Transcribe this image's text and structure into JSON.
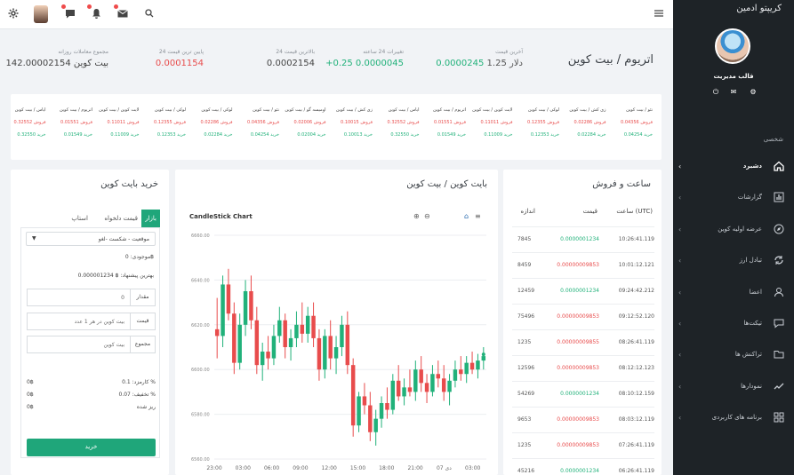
{
  "sidebar": {
    "brand": "کریپتو ادمین",
    "profile_name": "قالب مدیریت",
    "section_label": "شخصی",
    "items": [
      {
        "label": "دشبرد",
        "icon": "home-icon"
      },
      {
        "label": "گزارشات",
        "icon": "bar-chart-icon"
      },
      {
        "label": "عرضه اولیه کوین",
        "icon": "compass-icon"
      },
      {
        "label": "تبادل ارز",
        "icon": "exchange-icon"
      },
      {
        "label": "اعضا",
        "icon": "users-icon"
      },
      {
        "label": "تیکت‌ها",
        "icon": "chat-icon"
      },
      {
        "label": "تراکنش ها",
        "icon": "folder-icon"
      },
      {
        "label": "نمودارها",
        "icon": "trend-icon"
      },
      {
        "label": "برنامه های کاربردی",
        "icon": "apps-icon"
      }
    ]
  },
  "header": {
    "pair_title": "اتریوم / بیت کوین",
    "stats": [
      {
        "label": "آخرین قیمت",
        "value": "0.0000245",
        "extra": "1.25 دلار"
      },
      {
        "label": "تغییرات 24 ساعته",
        "value": "+0.25 0.0000045"
      },
      {
        "label": "بالاترین قیمت 24",
        "value": "0.0002154"
      },
      {
        "label": "پایین ترین قیمت 24",
        "value": "0.0001154"
      },
      {
        "label": "مجموع معاملات روزانه",
        "value": "142.00002154 بیت کوین"
      }
    ]
  },
  "ticker": [
    {
      "pair": "نئو / بیت کوین",
      "sell": "فروش 0.04356",
      "buy": "خرید 0.04254"
    },
    {
      "pair": "زی کش / بیت کوین",
      "sell": "فروش 0.02286",
      "buy": "خرید 0.02284"
    },
    {
      "pair": "لوکی / بیت کوین",
      "sell": "فروش 0.12355",
      "buy": "خرید 0.12353"
    },
    {
      "pair": "لایت کوین / بیت کوین",
      "sell": "فروش 0.11011",
      "buy": "خرید 0.11009"
    },
    {
      "pair": "اتریوم / بیت کوین",
      "sell": "فروش 0.01551",
      "buy": "خرید 0.01549"
    },
    {
      "pair": "ایاس / بیت کوین",
      "sell": "فروش 0.32552",
      "buy": "خرید 0.32550"
    },
    {
      "pair": "زی کش / بیت کوین",
      "sell": "فروش 0.10015",
      "buy": "خرید 0.10013"
    },
    {
      "pair": "اومیسه گو / بیت کوین",
      "sell": "فروش 0.02006",
      "buy": "خرید 0.02004"
    },
    {
      "pair": "نئو / بیت کوین",
      "sell": "فروش 0.04356",
      "buy": "خرید 0.04254"
    },
    {
      "pair": "لوکی / بیت کوین",
      "sell": "فروش 0.02286",
      "buy": "خرید 0.02284"
    },
    {
      "pair": "لوکی / بیت کوین",
      "sell": "فروش 0.12355",
      "buy": "خرید 0.12353"
    },
    {
      "pair": "لایت کوین / بیت کوین",
      "sell": "فروش 0.11011",
      "buy": "خرید 0.11009"
    },
    {
      "pair": "اتریوم / بیت کوین",
      "sell": "فروش 0.01551",
      "buy": "خرید 0.01549"
    },
    {
      "pair": "ایاس / بیت کوین",
      "sell": "فروش 0.32552",
      "buy": "خرید 0.32550"
    }
  ],
  "trades": {
    "title": "ساعت و فروش",
    "headers": [
      "ساعت (UTC)",
      "قیمت",
      "اندازه"
    ],
    "rows": [
      {
        "time": "10:26:41.119",
        "price": "0.0000001234",
        "size": "7845",
        "side": "buy"
      },
      {
        "time": "10:01:12.121",
        "price": "0.00000009853",
        "size": "8459",
        "side": "sell"
      },
      {
        "time": "09:24:42.212",
        "price": "0.0000001234",
        "size": "12459",
        "side": "buy"
      },
      {
        "time": "09:12:52.120",
        "price": "0.00000009853",
        "size": "75496",
        "side": "sell"
      },
      {
        "time": "08:26:41.119",
        "price": "0.00000009855",
        "size": "1235",
        "side": "sell"
      },
      {
        "time": "08:12:12.123",
        "price": "0.00000009853",
        "size": "12596",
        "side": "sell"
      },
      {
        "time": "08:10:12.159",
        "price": "0.0000001234",
        "size": "54269",
        "side": "buy"
      },
      {
        "time": "08:03:12.119",
        "price": "0.00000009853",
        "size": "9653",
        "side": "sell"
      },
      {
        "time": "07:26:41.119",
        "price": "0.00000009853",
        "size": "1235",
        "side": "sell"
      },
      {
        "time": "06:26:41.119",
        "price": "0.0000001234",
        "size": "45216",
        "side": "buy"
      }
    ]
  },
  "chart_card": {
    "title": "بایت کوین / بیت کوین"
  },
  "chart_data": {
    "type": "candlestick",
    "title": "CandleStick Chart",
    "ylim": [
      6560,
      6660
    ],
    "y_ticks": [
      "6660.00",
      "6640.00",
      "6620.00",
      "6600.00",
      "6580.00",
      "6560.00"
    ],
    "x_ticks": [
      "23:00",
      "03:00",
      "06:00",
      "09:00",
      "12:00",
      "15:00",
      "18:00",
      "21:00",
      "07 دی",
      "03:00"
    ],
    "candles": [
      [
        6618,
        6632,
        6605,
        6615
      ],
      [
        6615,
        6642,
        6610,
        6638
      ],
      [
        6638,
        6645,
        6622,
        6625
      ],
      [
        6625,
        6630,
        6598,
        6603
      ],
      [
        6603,
        6625,
        6600,
        6620
      ],
      [
        6620,
        6640,
        6615,
        6635
      ],
      [
        6635,
        6642,
        6618,
        6622
      ],
      [
        6622,
        6628,
        6598,
        6602
      ],
      [
        6602,
        6612,
        6595,
        6608
      ],
      [
        6608,
        6615,
        6600,
        6605
      ],
      [
        6605,
        6620,
        6602,
        6615
      ],
      [
        6615,
        6628,
        6612,
        6622
      ],
      [
        6622,
        6625,
        6605,
        6610
      ],
      [
        6610,
        6618,
        6604,
        6614
      ],
      [
        6614,
        6626,
        6610,
        6620
      ],
      [
        6620,
        6630,
        6612,
        6616
      ],
      [
        6616,
        6628,
        6612,
        6624
      ],
      [
        6624,
        6630,
        6610,
        6614
      ],
      [
        6614,
        6618,
        6595,
        6600
      ],
      [
        6600,
        6618,
        6596,
        6615
      ],
      [
        6615,
        6622,
        6600,
        6605
      ],
      [
        6605,
        6615,
        6598,
        6610
      ],
      [
        6610,
        6624,
        6606,
        6620
      ],
      [
        6620,
        6626,
        6598,
        6602
      ],
      [
        6602,
        6605,
        6570,
        6575
      ],
      [
        6575,
        6590,
        6572,
        6588
      ],
      [
        6588,
        6594,
        6580,
        6584
      ],
      [
        6584,
        6590,
        6568,
        6572
      ],
      [
        6572,
        6582,
        6566,
        6578
      ],
      [
        6578,
        6588,
        6574,
        6585
      ],
      [
        6585,
        6592,
        6578,
        6582
      ],
      [
        6582,
        6598,
        6580,
        6595
      ],
      [
        6595,
        6602,
        6586,
        6588
      ],
      [
        6588,
        6596,
        6584,
        6592
      ],
      [
        6592,
        6600,
        6588,
        6590
      ],
      [
        6590,
        6604,
        6586,
        6600
      ],
      [
        6600,
        6606,
        6590,
        6594
      ],
      [
        6594,
        6598,
        6585,
        6590
      ],
      [
        6590,
        6602,
        6588,
        6598
      ],
      [
        6598,
        6604,
        6592,
        6596
      ],
      [
        6596,
        6602,
        6586,
        6590
      ],
      [
        6590,
        6598,
        6584,
        6595
      ],
      [
        6595,
        6604,
        6592,
        6600
      ],
      [
        6600,
        6606,
        6595,
        6598
      ],
      [
        6598,
        6606,
        6594,
        6603
      ],
      [
        6603,
        6608,
        6598,
        6600
      ],
      [
        6600,
        6607,
        6596,
        6604
      ],
      [
        6604,
        6610,
        6600,
        6606
      ]
    ]
  },
  "buy_card": {
    "title": "خرید بایت کوین",
    "tabs": [
      "بازار",
      "قیمت دلخواه",
      "استاپ"
    ],
    "status_value": "موقعیت - شکست -لغو",
    "available": "موجودی: 0฿",
    "best_offer": "بهترین پیشنهاد: ฿ 0.000001234",
    "fields": [
      {
        "label": "مقدار",
        "value": "0"
      },
      {
        "label": "قیمت",
        "value": "بیت کوین در هر 1 عدد"
      },
      {
        "label": "مجموع",
        "value": "بیت کوین"
      }
    ],
    "fees": [
      {
        "label": "کارمزد: 0.1 %",
        "value": "0฿"
      },
      {
        "label": "تخفیف: 0.07 %",
        "value": "0฿"
      },
      {
        "label": "ریز شده",
        "value": "0฿"
      }
    ],
    "buy_label": "خرید"
  },
  "colors": {
    "green": "#21b17a",
    "red": "#e84c4c",
    "sidebar": "#1e2327",
    "accent": "#1fa67a"
  }
}
